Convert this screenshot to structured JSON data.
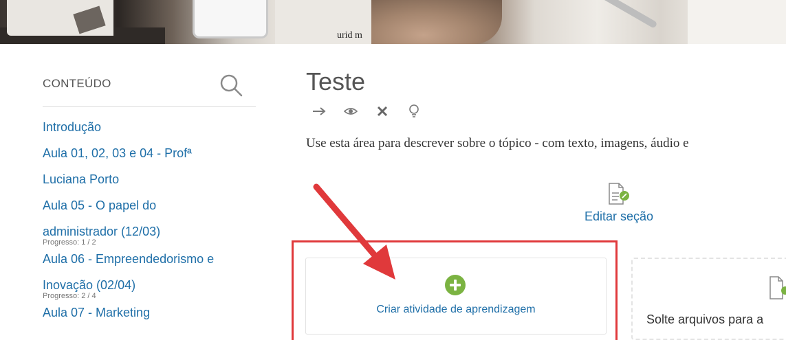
{
  "sidebar": {
    "title": "CONTEÚDO",
    "items": [
      {
        "label": "Introdução"
      },
      {
        "label": "Aula 01, 02, 03 e 04 - Profª"
      },
      {
        "label": "Luciana Porto"
      },
      {
        "label": "Aula 05 - O papel do"
      },
      {
        "label": "administrador (12/03)"
      },
      {
        "progress": "Progresso: 1 / 2"
      },
      {
        "label": "Aula 06 - Empreendedorismo e"
      },
      {
        "label": "Inovação (02/04)"
      },
      {
        "progress": "Progresso: 2 / 4"
      },
      {
        "label": "Aula 07 - Marketing"
      }
    ]
  },
  "main": {
    "title": "Teste",
    "action_icons": [
      "arrow-right-icon",
      "eye-icon",
      "close-icon",
      "lightbulb-icon"
    ],
    "description": "Use esta área para descrever sobre o tópico - com texto, imagens, áudio e",
    "edit_section_label": "Editar seção",
    "create_activity_label": "Criar atividade de aprendizagem",
    "drop_files_label": "Solte arquivos para a"
  },
  "colors": {
    "link": "#1f6fa8",
    "highlight": "#e0393b",
    "plus": "#7bb342"
  }
}
